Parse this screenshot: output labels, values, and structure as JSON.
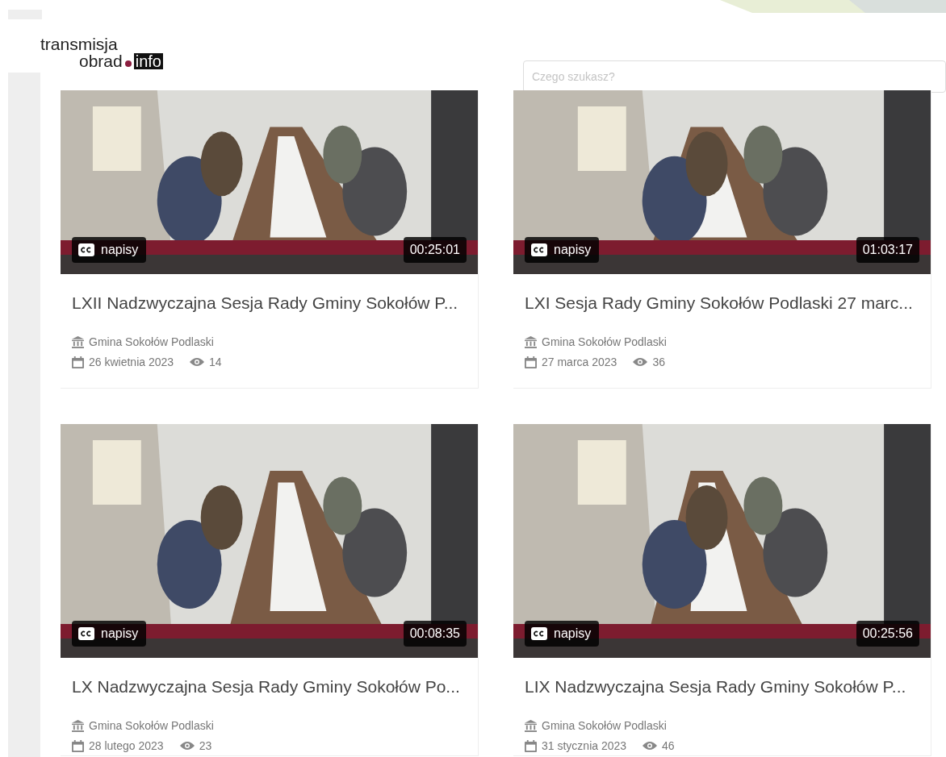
{
  "logo": {
    "line_1": "transmisja",
    "line_2": "obrad",
    "badge": "info"
  },
  "search": {
    "placeholder": "Czego szukasz?"
  },
  "videos": [
    {
      "caption_label": "napisy",
      "duration": "00:25:01",
      "title": "LXII Nadzwyczajna Sesja Rady Gminy Sokołów P...",
      "organizer": "Gmina Sokołów Podlaski",
      "date": "26 kwietnia 2023",
      "views": "14"
    },
    {
      "caption_label": "napisy",
      "duration": "01:03:17",
      "title": "LXI Sesja Rady Gminy Sokołów Podlaski 27 marc...",
      "organizer": "Gmina Sokołów Podlaski",
      "date": "27 marca 2023",
      "views": "36"
    },
    {
      "caption_label": "napisy",
      "duration": "00:08:35",
      "title": "LX Nadzwyczajna Sesja Rady Gminy Sokołów Po...",
      "organizer": "Gmina Sokołów Podlaski",
      "date": "28 lutego 2023",
      "views": "23"
    },
    {
      "caption_label": "napisy",
      "duration": "00:25:56",
      "title": "LIX Nadzwyczajna Sesja Rady Gminy Sokołów P...",
      "organizer": "Gmina Sokołów Podlaski",
      "date": "31 stycznia 2023",
      "views": "46"
    }
  ]
}
